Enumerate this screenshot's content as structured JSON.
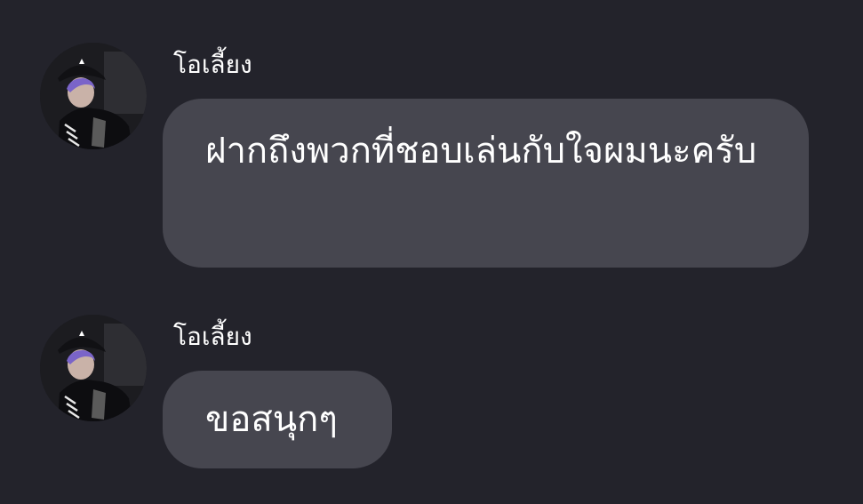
{
  "chat": {
    "messages": [
      {
        "sender": "โอเลี้ยง",
        "avatar_icon": "profile-photo",
        "text": "ฝากถึงพวกที่ชอบเล่นกับใจผมนะครับ"
      },
      {
        "sender": "โอเลี้ยง",
        "avatar_icon": "profile-photo",
        "text": "ขอสนุกๆ"
      }
    ]
  },
  "colors": {
    "background": "#23232b",
    "bubble": "#46464f",
    "text": "#ffffff"
  }
}
